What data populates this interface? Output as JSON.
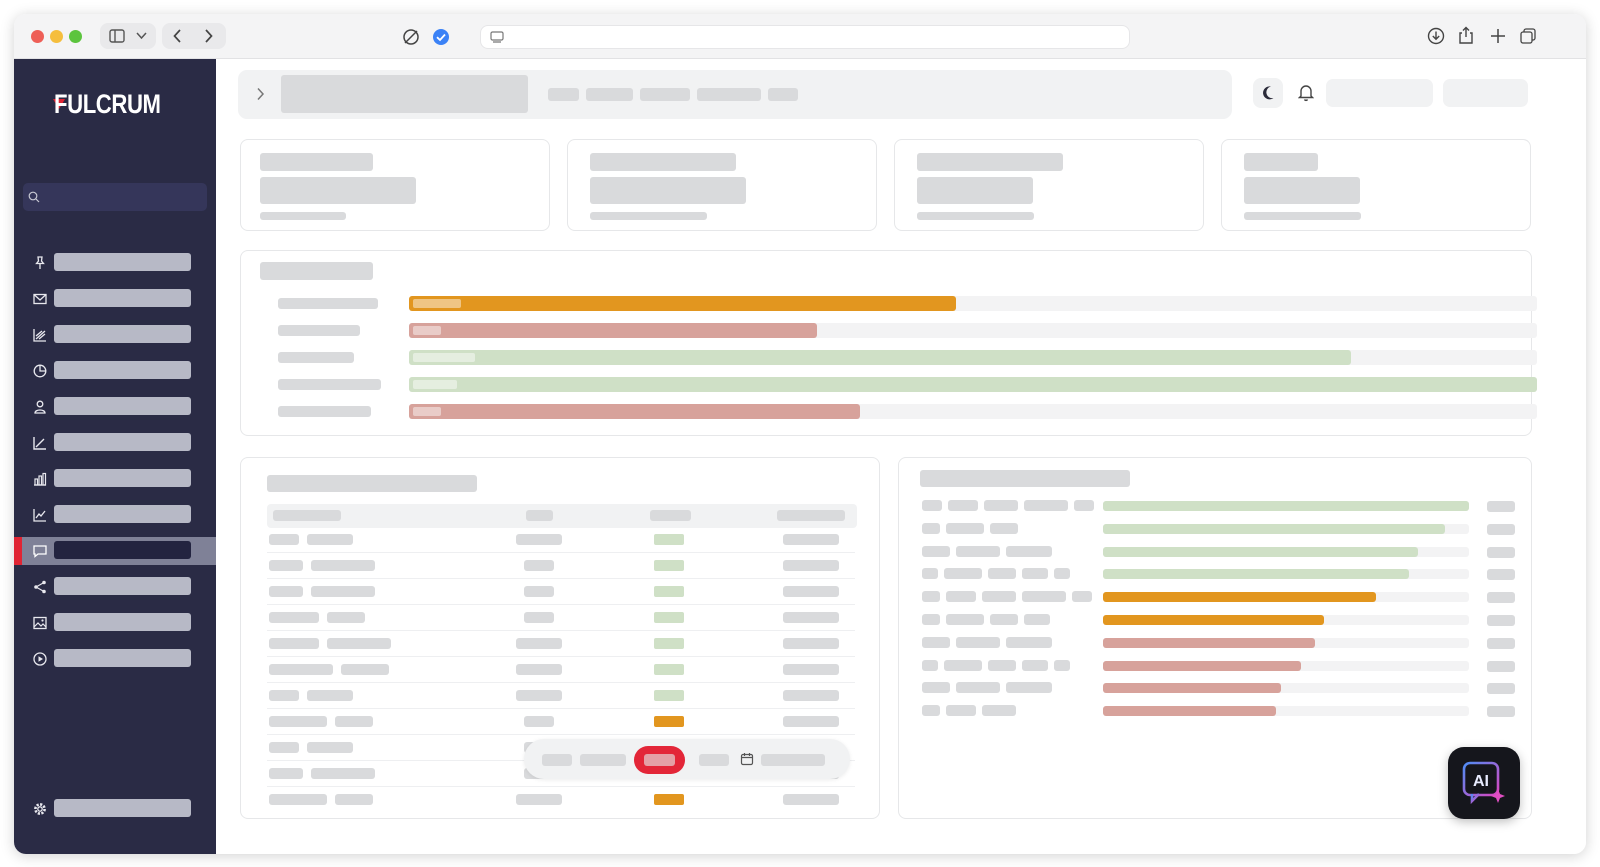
{
  "app": {
    "logo_text": "FULCRUM"
  },
  "colors": {
    "sidebar_bg": "#2a2b45",
    "active_indicator": "#e02433",
    "orange": "#e2961f",
    "red": "#d7a29b",
    "green": "#cfe0c6",
    "record_button": "#e32638"
  },
  "browser": {
    "icons": [
      "close-dot",
      "minimize-dot",
      "zoom-dot",
      "sidebar-toggle-icon",
      "chevron-down-icon",
      "back-icon",
      "forward-icon",
      "privacy-icon",
      "verified-icon",
      "reader-icon",
      "download-icon",
      "share-icon",
      "new-tab-icon",
      "tabs-overview-icon"
    ]
  },
  "sidebar": {
    "icons": [
      "pin-icon",
      "mail-icon",
      "stacked-chart-icon",
      "pie-chart-icon",
      "user-icon",
      "line-chart-icon",
      "bar-chart-icon",
      "trend-icon",
      "chat-icon",
      "share-icon",
      "image-icon",
      "play-icon"
    ],
    "active_index": 8,
    "footer_icon": "gear-icon"
  },
  "topbar": {
    "icons": [
      "chevron-right-icon",
      "moon-icon",
      "bell-icon"
    ]
  },
  "progress_card": {
    "rows": [
      {
        "color": "orange",
        "fraction": 0.485
      },
      {
        "color": "red",
        "fraction": 0.362
      },
      {
        "color": "green",
        "fraction": 0.835
      },
      {
        "color": "green",
        "fraction": 1.0
      },
      {
        "color": "red",
        "fraction": 0.4
      }
    ]
  },
  "table_card": {
    "status_colors": [
      "green",
      "green",
      "green",
      "green",
      "green",
      "green",
      "green",
      "orange",
      "orange",
      "orange",
      "orange"
    ]
  },
  "bars_card": {
    "rows": [
      {
        "color": "green",
        "fraction": 1.0
      },
      {
        "color": "green",
        "fraction": 0.935
      },
      {
        "color": "green",
        "fraction": 0.86
      },
      {
        "color": "green",
        "fraction": 0.837
      },
      {
        "color": "orange",
        "fraction": 0.745
      },
      {
        "color": "orange",
        "fraction": 0.605
      },
      {
        "color": "red",
        "fraction": 0.578
      },
      {
        "color": "red",
        "fraction": 0.54
      },
      {
        "color": "red",
        "fraction": 0.487
      },
      {
        "color": "red",
        "fraction": 0.474
      }
    ]
  },
  "bottom_bar": {
    "icons": [
      "calendar-icon"
    ],
    "active_index": 2
  },
  "ai_button": {
    "label": "AI",
    "icon": "sparkle-icon"
  }
}
